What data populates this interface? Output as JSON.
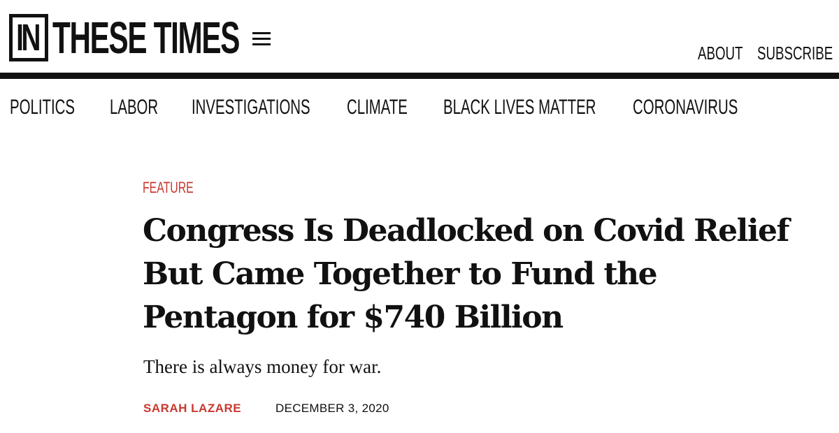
{
  "header": {
    "logo_box": "IN",
    "logo_word": "THESE TIMES",
    "menu_icon": "hamburger-menu-icon",
    "util_links": [
      "ABOUT",
      "SUBSCRIBE"
    ]
  },
  "nav": {
    "items": [
      "POLITICS",
      "LABOR",
      "INVESTIGATIONS",
      "CLIMATE",
      "BLACK LIVES MATTER",
      "CORONAVIRUS"
    ]
  },
  "article": {
    "kicker": "FEATURE",
    "headline": "Congress Is Deadlocked on Covid Relief But Came Together to Fund the Pentagon for $740 Billion",
    "dek": "There is always money for war.",
    "author": "SARAH LAZARE",
    "date": "DECEMBER 3, 2020"
  },
  "colors": {
    "accent": "#c8382f",
    "text": "#111111",
    "background": "#ffffff"
  }
}
